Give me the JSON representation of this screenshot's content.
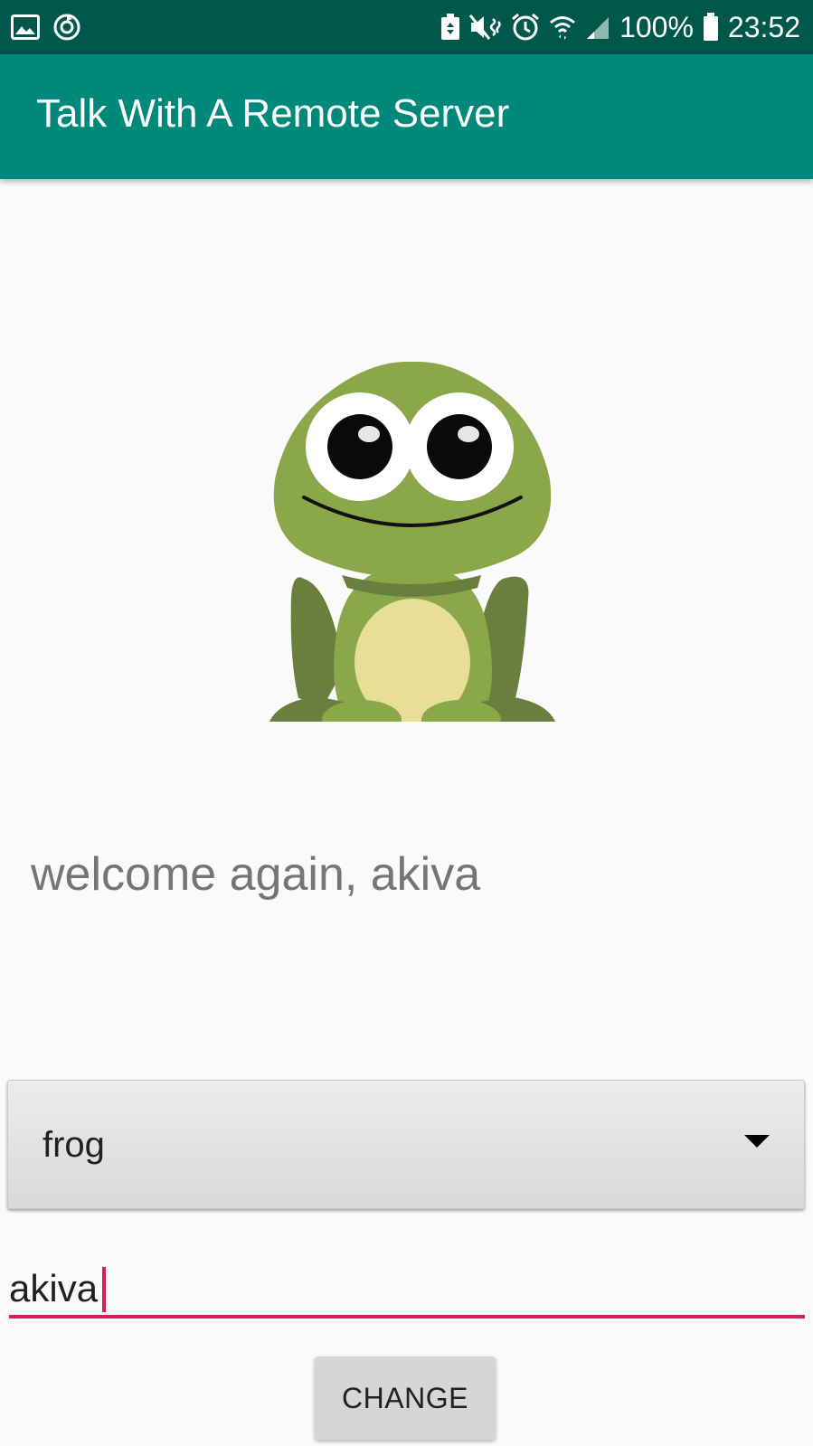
{
  "status_bar": {
    "battery": "100%",
    "time": "23:52",
    "icons": [
      "image-icon",
      "sync-icon",
      "battery-saver-icon",
      "mute-vibrate-icon",
      "alarm-icon",
      "wifi-icon",
      "signal-icon",
      "battery-icon"
    ]
  },
  "app_bar": {
    "title": "Talk With A Remote Server"
  },
  "main": {
    "image": "frog-icon",
    "welcome": "welcome again, akiva",
    "spinner": {
      "selected": "frog"
    },
    "name_input": {
      "value": "akiva"
    },
    "change_label": "CHANGE"
  },
  "colors": {
    "status_bar": "#00574b",
    "app_bar": "#00897b",
    "accent": "#d81b60",
    "background": "#fafafa"
  }
}
